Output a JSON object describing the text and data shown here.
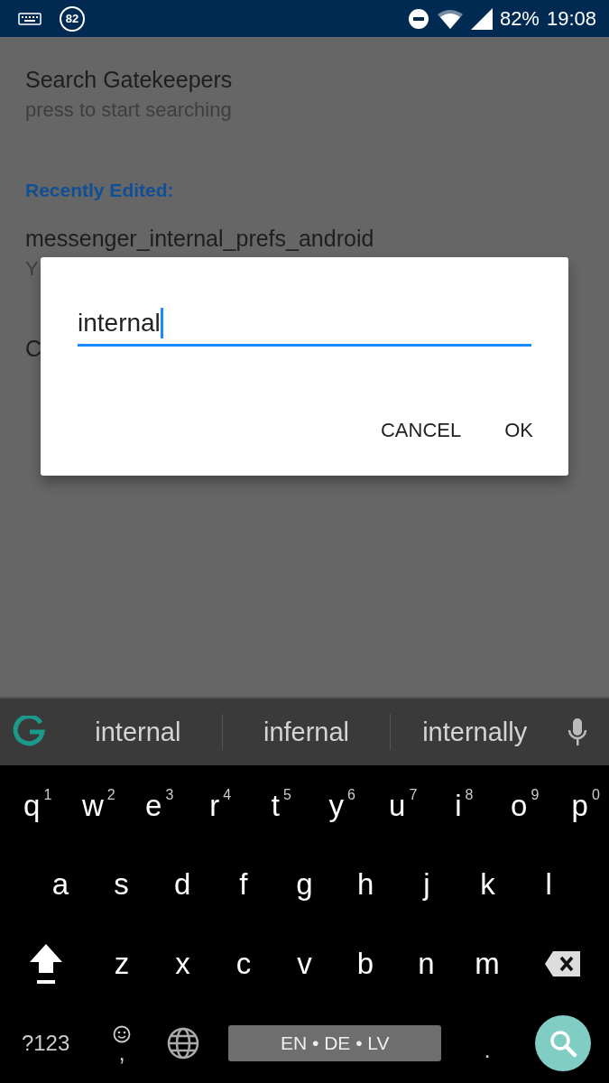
{
  "status_bar": {
    "notification_count": "82",
    "battery": "82%",
    "time": "19:08"
  },
  "screen": {
    "title": "Search Gatekeepers",
    "subtitle": "press to start searching",
    "section_header": "Recently Edited:",
    "items": [
      {
        "title": "messenger_internal_prefs_android",
        "subtitle": "Y"
      },
      {
        "title": "C"
      }
    ]
  },
  "dialog": {
    "input": {
      "value": "internal"
    },
    "buttons": [
      "CANCEL",
      "OK"
    ]
  },
  "keyboard": {
    "suggestions": [
      "internal",
      "infernal",
      "internally"
    ],
    "rows": [
      {
        "keys": [
          {
            "kind": "letter",
            "label": "q",
            "hint": "1"
          },
          {
            "kind": "letter",
            "label": "w",
            "hint": "2"
          },
          {
            "kind": "letter",
            "label": "e",
            "hint": "3"
          },
          {
            "kind": "letter",
            "label": "r",
            "hint": "4"
          },
          {
            "kind": "letter",
            "label": "t",
            "hint": "5"
          },
          {
            "kind": "letter",
            "label": "y",
            "hint": "6"
          },
          {
            "kind": "letter",
            "label": "u",
            "hint": "7"
          },
          {
            "kind": "letter",
            "label": "i",
            "hint": "8"
          },
          {
            "kind": "letter",
            "label": "o",
            "hint": "9"
          },
          {
            "kind": "letter",
            "label": "p",
            "hint": "0"
          }
        ]
      },
      {
        "keys": [
          {
            "kind": "letter",
            "label": "a"
          },
          {
            "kind": "letter",
            "label": "s"
          },
          {
            "kind": "letter",
            "label": "d"
          },
          {
            "kind": "letter",
            "label": "f"
          },
          {
            "kind": "letter",
            "label": "g"
          },
          {
            "kind": "letter",
            "label": "h"
          },
          {
            "kind": "letter",
            "label": "j"
          },
          {
            "kind": "letter",
            "label": "k"
          },
          {
            "kind": "letter",
            "label": "l"
          }
        ]
      },
      {
        "keys": [
          {
            "kind": "shift"
          },
          {
            "kind": "letter",
            "label": "z"
          },
          {
            "kind": "letter",
            "label": "x"
          },
          {
            "kind": "letter",
            "label": "c"
          },
          {
            "kind": "letter",
            "label": "v"
          },
          {
            "kind": "letter",
            "label": "b"
          },
          {
            "kind": "letter",
            "label": "n"
          },
          {
            "kind": "letter",
            "label": "m"
          },
          {
            "kind": "backspace"
          }
        ]
      },
      {
        "keys": [
          {
            "kind": "symbols",
            "label": "?123"
          },
          {
            "kind": "emoji",
            "label": ","
          },
          {
            "kind": "globe"
          },
          {
            "kind": "space",
            "label": "EN • DE • LV"
          },
          {
            "kind": "period",
            "label": "."
          },
          {
            "kind": "search"
          }
        ]
      }
    ]
  }
}
